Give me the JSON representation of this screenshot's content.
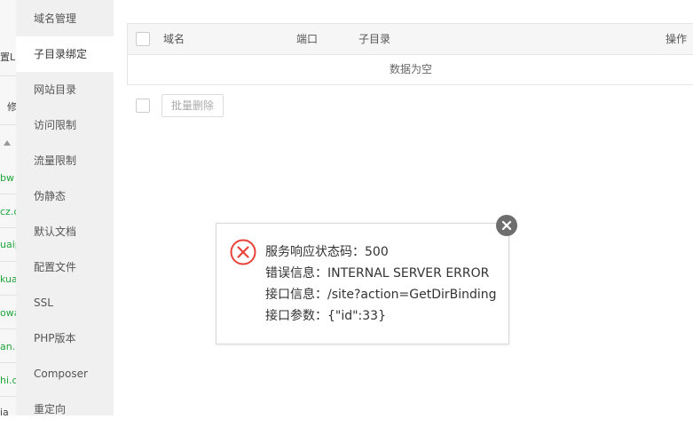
{
  "background_fragments": [
    "置Li",
    "修",
    "bw",
    "cz.c",
    "uaip",
    "kua",
    "owa",
    "an.c",
    "hi.c",
    "ia"
  ],
  "sidebar": {
    "items": [
      {
        "label": "域名管理"
      },
      {
        "label": "子目录绑定"
      },
      {
        "label": "网站目录"
      },
      {
        "label": "访问限制"
      },
      {
        "label": "流量限制"
      },
      {
        "label": "伪静态"
      },
      {
        "label": "默认文档"
      },
      {
        "label": "配置文件"
      },
      {
        "label": "SSL"
      },
      {
        "label": "PHP版本"
      },
      {
        "label": "Composer"
      },
      {
        "label": "重定向"
      }
    ],
    "active_index": 1
  },
  "table": {
    "columns": [
      "域名",
      "端口",
      "子目录",
      "操作"
    ],
    "empty_text": "数据为空"
  },
  "bulk": {
    "delete_label": "批量删除"
  },
  "error_dialog": {
    "status_line": "服务响应状态码：500",
    "error_line": "错误信息：INTERNAL SERVER ERROR",
    "api_line": "接口信息：/site?action=GetDirBinding",
    "params_line": "接口参数：{\"id\":33}"
  },
  "colors": {
    "error_red": "#e8433a",
    "sidebar_bg": "#f0f0f0",
    "close_bg": "#6e6e6e"
  }
}
